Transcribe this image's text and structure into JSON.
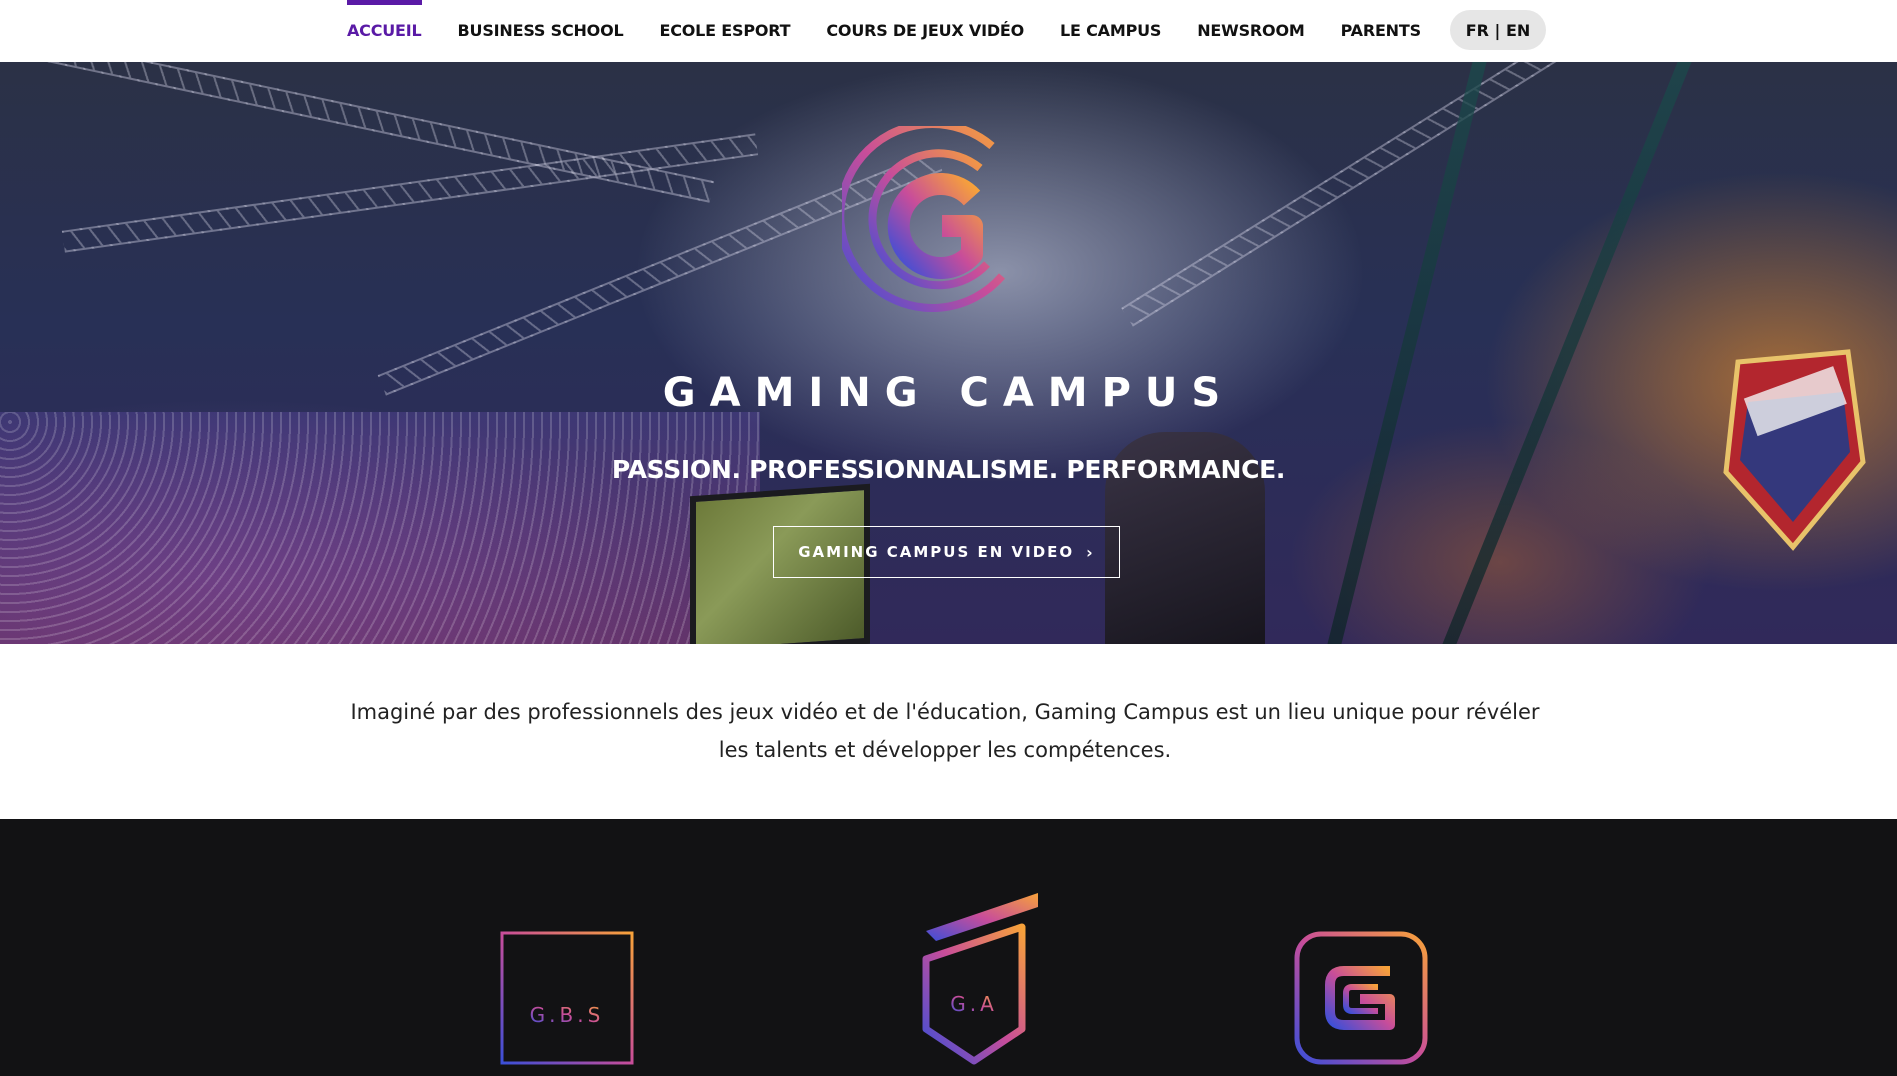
{
  "nav": {
    "items": [
      {
        "label": "ACCUEIL",
        "active": true
      },
      {
        "label": "BUSINESS SCHOOL",
        "active": false
      },
      {
        "label": "ECOLE ESPORT",
        "active": false
      },
      {
        "label": "COURS DE JEUX VIDÉO",
        "active": false
      },
      {
        "label": "LE CAMPUS",
        "active": false
      },
      {
        "label": "NEWSROOM",
        "active": false
      },
      {
        "label": "PARENTS",
        "active": false
      }
    ],
    "language": "FR | EN"
  },
  "hero": {
    "brand": "GAMING CAMPUS",
    "tagline": "PASSION. PROFESSIONNALISME. PERFORMANCE.",
    "video_button": "GAMING CAMPUS EN VIDEO",
    "video_button_icon": "chevron-right-icon",
    "logo_icon": "gaming-campus-logo"
  },
  "intro": {
    "text": "Imaginé par des professionnels des jeux vidéo et de l'éducation, Gaming Campus est un lieu unique pour révéler les talents et développer les compétences."
  },
  "schools": [
    {
      "name": "gbs-logo",
      "label": "G.B.S"
    },
    {
      "name": "ga-logo",
      "label": "G.A"
    },
    {
      "name": "g-logo",
      "label": ""
    }
  ],
  "colors": {
    "accent": "#5a1aa6",
    "gradient_start": "#f7a23a",
    "gradient_mid": "#c84d9a",
    "gradient_end": "#3b4fd8",
    "dark_bg": "#121214"
  }
}
